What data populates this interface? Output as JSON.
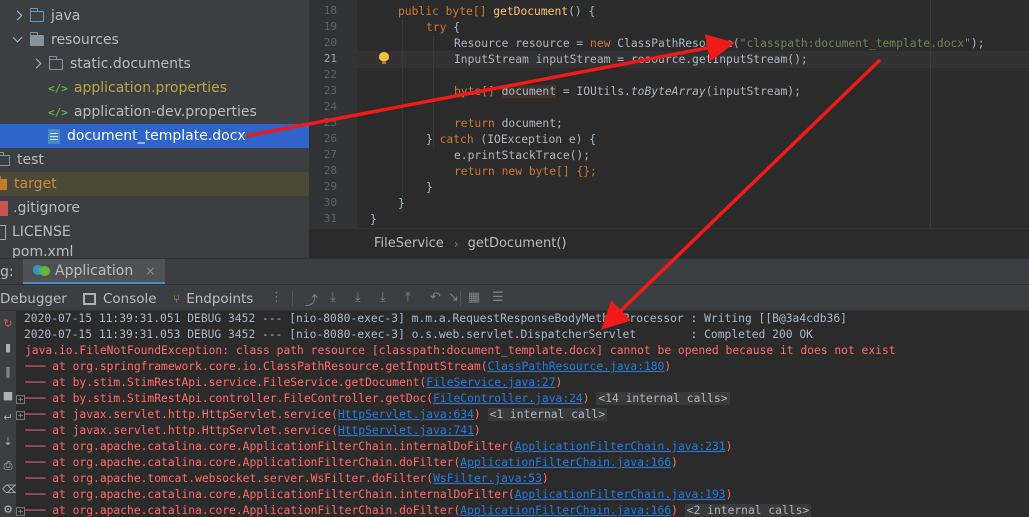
{
  "project_tree": {
    "items": [
      {
        "label": "java"
      },
      {
        "label": "resources"
      },
      {
        "label": "static.documents"
      },
      {
        "label": "application.properties"
      },
      {
        "label": "application-dev.properties"
      },
      {
        "label": "document_template.docx"
      },
      {
        "label": "test"
      },
      {
        "label": "target"
      },
      {
        "label": ".gitignore"
      },
      {
        "label": "LICENSE"
      },
      {
        "label": "pom.xml"
      }
    ]
  },
  "editor": {
    "line_numbers": [
      "18",
      "19",
      "20",
      "21",
      "22",
      "23",
      "24",
      "25",
      "26",
      "27",
      "28",
      "29",
      "30",
      "31"
    ],
    "current_line": "21",
    "lines": {
      "l18_kw1": "public",
      "l18_type": "byte[]",
      "l18_fn": "getDocument",
      "l18_rest": "() {",
      "l19_kw": "try",
      "l19_rest": " {",
      "l20_a": "Resource resource = ",
      "l20_kw": "new",
      "l20_b": " ClassPathResource(",
      "l20_str": "\"classpath:document_template.docx\"",
      "l20_c": ");",
      "l21": "InputStream inputStream = resource.getInputStream();",
      "l23_a": "byte[] ",
      "l23_var": "document",
      "l23_b": " = IOUtils.",
      "l23_it": "toByteArray",
      "l23_c": "(inputStream);",
      "l25_kw": "return",
      "l25_rest": " document;",
      "l26_a": "} ",
      "l26_kw": "catch",
      "l26_b": " (IOException e) {",
      "l27": "e.printStackTrace();",
      "l28_kw1": "return",
      "l28_kw2": "new",
      "l28_rest": " byte[] {};",
      "l29": "}",
      "l30": "}",
      "l31": "}"
    }
  },
  "breadcrumb": {
    "class_name": "FileService",
    "method_name": "getDocument()"
  },
  "run_window": {
    "title_prefix": "g:",
    "tab_label": "Application",
    "close_glyph": "×"
  },
  "toolbar": {
    "debugger": "Debugger",
    "console": "Console",
    "endpoints": "Endpoints"
  },
  "console": {
    "debug1": "2020-07-15 11:39:31.051 DEBUG 3452 --- [nio-8080-exec-3] m.m.a.RequestResponseBodyMethodProcessor : Writing [[B@3a4cdb36]",
    "debug2": "2020-07-15 11:39:31.053 DEBUG 3452 --- [nio-8080-exec-3] o.s.web.servlet.DispatcherServlet        : Completed 200 OK",
    "exception": "java.io.FileNotFoundException: class path resource [classpath:document_template.docx] cannot be opened because it does not exist",
    "traces": [
      {
        "text": "at org.springframework.core.io.ClassPathResource.getInputStream(",
        "link": "ClassPathResource.java:180",
        "tail": ")",
        "badge": ""
      },
      {
        "text": "at by.stim.StimRestApi.service.FileService.getDocument(",
        "link": "FileService.java:27",
        "tail": ")",
        "badge": ""
      },
      {
        "text": "at by.stim.StimRestApi.controller.FileController.getDoc(",
        "link": "FileController.java:24",
        "tail": ")",
        "badge": "<14 internal calls>"
      },
      {
        "text": "at javax.servlet.http.HttpServlet.service(",
        "link": "HttpServlet.java:634",
        "tail": ")",
        "badge": "<1 internal call>"
      },
      {
        "text": "at javax.servlet.http.HttpServlet.service(",
        "link": "HttpServlet.java:741",
        "tail": ")",
        "badge": ""
      },
      {
        "text": "at org.apache.catalina.core.ApplicationFilterChain.internalDoFilter(",
        "link": "ApplicationFilterChain.java:231",
        "tail": ")",
        "badge": ""
      },
      {
        "text": "at org.apache.catalina.core.ApplicationFilterChain.doFilter(",
        "link": "ApplicationFilterChain.java:166",
        "tail": ")",
        "badge": ""
      },
      {
        "text": "at org.apache.tomcat.websocket.server.WsFilter.doFilter(",
        "link": "WsFilter.java:53",
        "tail": ")",
        "badge": ""
      },
      {
        "text": "at org.apache.catalina.core.ApplicationFilterChain.internalDoFilter(",
        "link": "ApplicationFilterChain.java:193",
        "tail": ")",
        "badge": ""
      },
      {
        "text": "at org.apache.catalina.core.ApplicationFilterChain.doFilter(",
        "link": "ApplicationFilterChain.java:166",
        "tail": ")",
        "badge": "<2 internal calls>"
      }
    ]
  },
  "colors": {
    "annotation_arrow": "#f01a1a",
    "selection": "#2f65ca",
    "error_text": "#ff6b68",
    "link": "#287bde"
  }
}
